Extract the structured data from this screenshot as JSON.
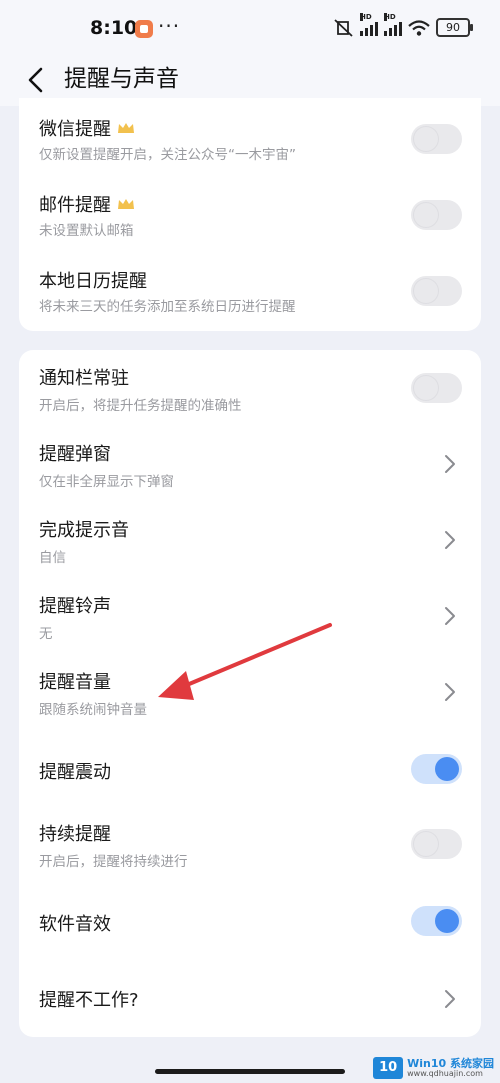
{
  "status": {
    "time": "8:10",
    "dots": "···",
    "battery": "90",
    "hd1": "HD",
    "hd2": "HD"
  },
  "header": {
    "title": "提醒与声音"
  },
  "card1": [
    {
      "label": "微信提醒",
      "sub": "仅新设置提醒开启，关注公众号“一木宇宙”",
      "vip": true,
      "toggle": false
    },
    {
      "label": "邮件提醒",
      "sub": "未设置默认邮箱",
      "vip": true,
      "toggle": false
    },
    {
      "label": "本地日历提醒",
      "sub": "将未来三天的任务添加至系统日历进行提醒",
      "vip": false,
      "toggle": false
    }
  ],
  "card2": [
    {
      "label": "通知栏常驻",
      "sub": "开启后，将提升任务提醒的准确性",
      "control": "toggle",
      "on": false
    },
    {
      "label": "提醒弹窗",
      "sub": "仅在非全屏显示下弹窗",
      "control": "chevron"
    },
    {
      "label": "完成提示音",
      "sub": "自信",
      "control": "chevron"
    },
    {
      "label": "提醒铃声",
      "sub": "无",
      "control": "chevron"
    },
    {
      "label": "提醒音量",
      "sub": "跟随系统闹钟音量",
      "control": "chevron"
    },
    {
      "label": "提醒震动",
      "sub": "",
      "control": "toggle",
      "on": true
    },
    {
      "label": "持续提醒",
      "sub": "开启后，提醒将持续进行",
      "control": "toggle",
      "on": false
    },
    {
      "label": "软件音效",
      "sub": "",
      "control": "toggle",
      "on": true
    },
    {
      "label": "提醒不工作?",
      "sub": "",
      "control": "chevron"
    }
  ],
  "watermark": {
    "logo": "10",
    "name": "Win10 系统家园",
    "url": "www.qdhuajin.com"
  },
  "colors": {
    "accent": "#4a8df2",
    "arrow": "#e03a3e",
    "background": "#eef0f7"
  }
}
